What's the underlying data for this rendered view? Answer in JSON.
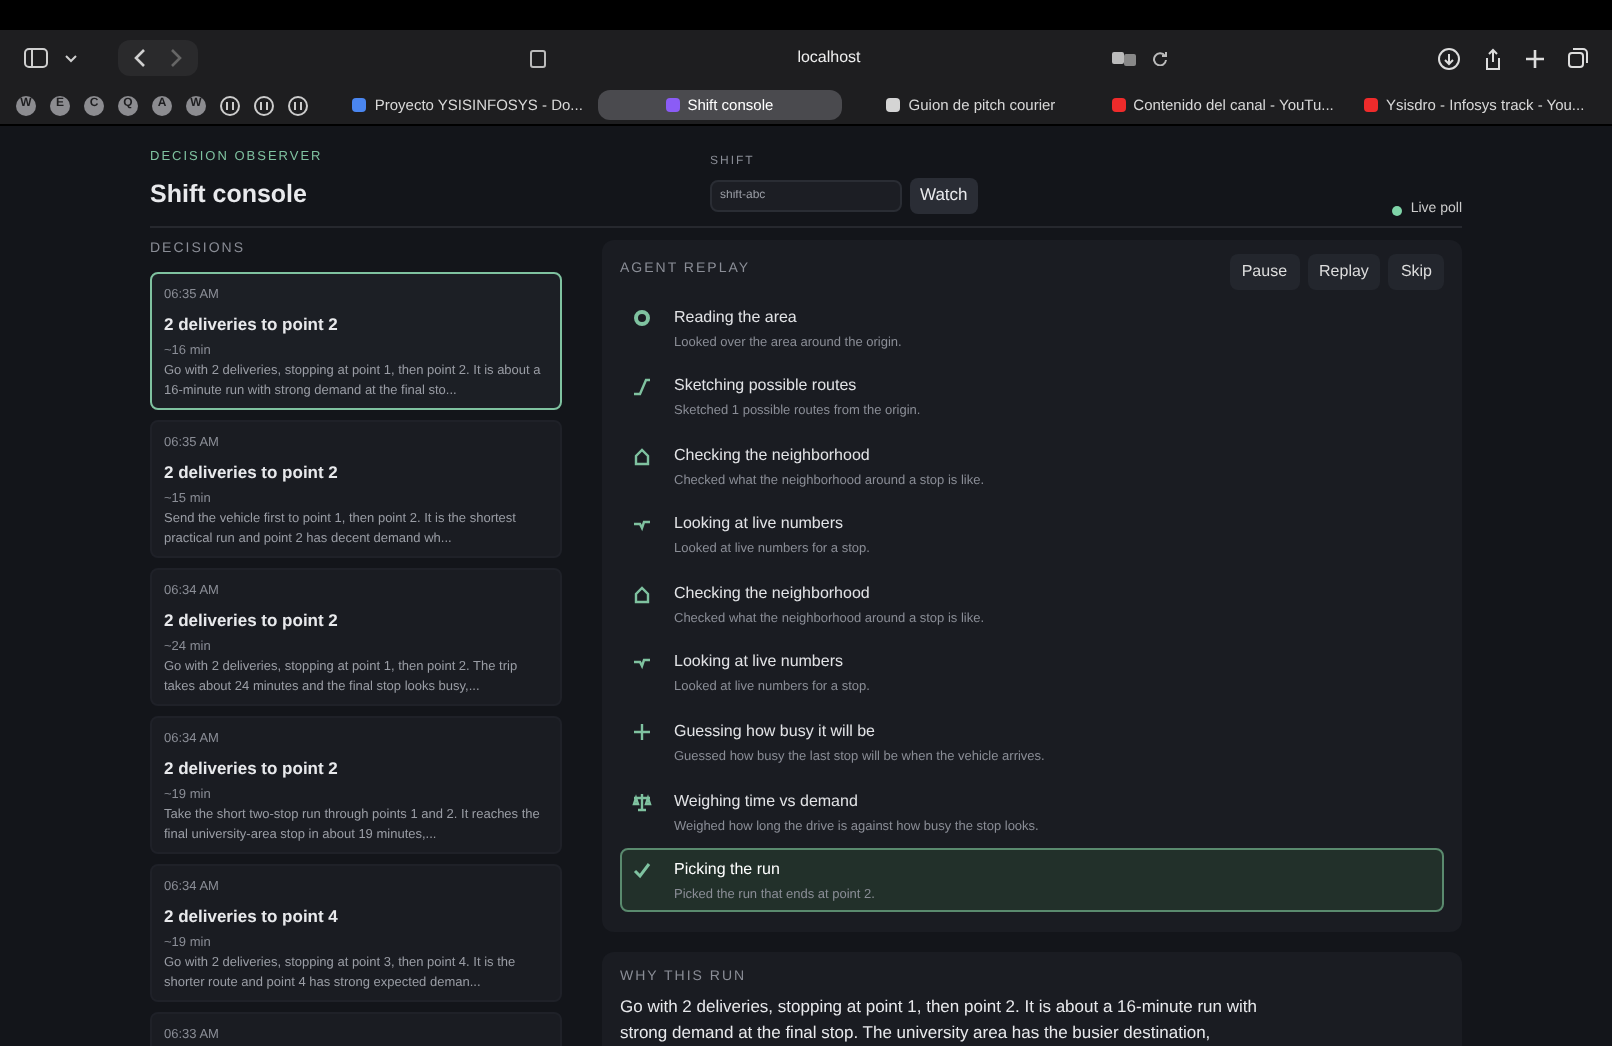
{
  "browser": {
    "address": "localhost",
    "bookmarks": [
      {
        "kind": "letter",
        "label": "W"
      },
      {
        "kind": "letter",
        "label": "E"
      },
      {
        "kind": "letter",
        "label": "C"
      },
      {
        "kind": "letter",
        "label": "Q"
      },
      {
        "kind": "letter",
        "label": "A"
      },
      {
        "kind": "letter",
        "label": "W"
      },
      {
        "kind": "glyph"
      },
      {
        "kind": "glyph"
      },
      {
        "kind": "glyph"
      }
    ],
    "tabs": [
      {
        "label": "Proyecto YSISINFOSYS - Do...",
        "selected": false,
        "color": "#4a86f0"
      },
      {
        "label": "Shift console",
        "selected": true,
        "color": "#8b5cf6"
      },
      {
        "label": "Guion de pitch courier",
        "selected": false,
        "color": "#d4d4d4"
      },
      {
        "label": "Contenido del canal - YouTu...",
        "selected": false,
        "color": "#ef2b2b"
      },
      {
        "label": "Ysisdro - Infosys track - You...",
        "selected": false,
        "color": "#ef2b2b"
      }
    ]
  },
  "header": {
    "eyebrow": "DECISION OBSERVER",
    "title": "Shift console",
    "shift_label": "SHIFT",
    "shift_placeholder": "shift-abc",
    "watch_button": "Watch",
    "live_label": "Live poll",
    "live": true
  },
  "decisions": {
    "heading": "DECISIONS",
    "items": [
      {
        "time": "06:35 AM",
        "title": "2 deliveries to point 2",
        "duration": "~16 min",
        "summary": "Go with 2 deliveries, stopping at point 1, then point 2. It is about a 16-minute run with strong demand at the final sto...",
        "selected": true
      },
      {
        "time": "06:35 AM",
        "title": "2 deliveries to point 2",
        "duration": "~15 min",
        "summary": "Send the vehicle first to point 1, then point 2. It is the shortest practical run and point 2 has decent demand wh...",
        "selected": false
      },
      {
        "time": "06:34 AM",
        "title": "2 deliveries to point 2",
        "duration": "~24 min",
        "summary": "Go with 2 deliveries, stopping at point 1, then point 2. The trip takes about 24 minutes and the final stop looks busy,...",
        "selected": false
      },
      {
        "time": "06:34 AM",
        "title": "2 deliveries to point 2",
        "duration": "~19 min",
        "summary": "Take the short two-stop run through points 1 and 2. It reaches the final university-area stop in about 19 minutes,...",
        "selected": false
      },
      {
        "time": "06:34 AM",
        "title": "2 deliveries to point 4",
        "duration": "~19 min",
        "summary": "Go with 2 deliveries, stopping at point 3, then point 4. It is the shorter route and point 4 has strong expected deman...",
        "selected": false
      },
      {
        "time": "06:33 AM",
        "selected": false
      }
    ]
  },
  "replay": {
    "heading": "AGENT REPLAY",
    "buttons": [
      "Pause",
      "Replay",
      "Skip"
    ],
    "steps": [
      {
        "kind": "area",
        "title": "Reading the area",
        "detail": "Looked over the area around the origin.",
        "selected": false
      },
      {
        "kind": "route",
        "title": "Sketching possible routes",
        "detail": "Sketched 1 possible routes from the origin.",
        "selected": false
      },
      {
        "kind": "neighborhood",
        "title": "Checking the neighborhood",
        "detail": "Checked what the neighborhood around a stop is like.",
        "selected": false
      },
      {
        "kind": "live",
        "title": "Looking at live numbers",
        "detail": "Looked at live numbers for a stop.",
        "selected": false
      },
      {
        "kind": "neighborhood",
        "title": "Checking the neighborhood",
        "detail": "Checked what the neighborhood around a stop is like.",
        "selected": false
      },
      {
        "kind": "live",
        "title": "Looking at live numbers",
        "detail": "Looked at live numbers for a stop.",
        "selected": false
      },
      {
        "kind": "guess",
        "title": "Guessing how busy it will be",
        "detail": "Guessed how busy the last stop will be when the vehicle arrives.",
        "selected": false
      },
      {
        "kind": "weigh",
        "title": "Weighing time vs demand",
        "detail": "Weighed how long the drive is against how busy the stop looks.",
        "selected": false
      },
      {
        "kind": "pick",
        "title": "Picking the run",
        "detail": "Picked the run that ends at point 2.",
        "selected": true
      }
    ]
  },
  "why": {
    "heading": "WHY THIS RUN",
    "text": "Go with 2 deliveries, stopping at point 1, then point 2. It is about a 16-minute run with strong demand at the final stop. The university area has the busier destination,"
  }
}
